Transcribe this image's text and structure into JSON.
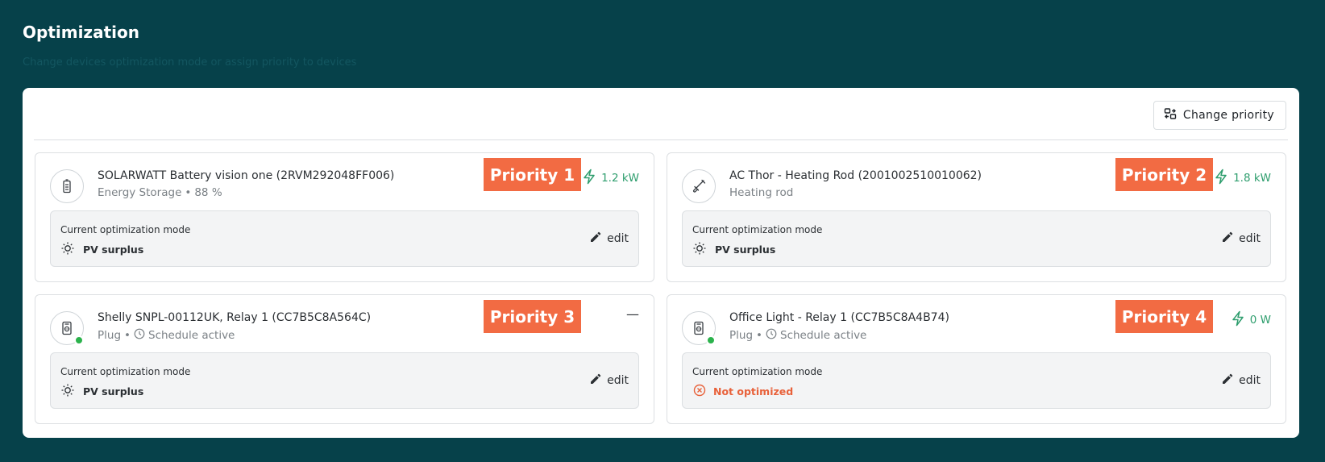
{
  "page": {
    "title": "Optimization",
    "subtitle": "Change devices optimization mode or assign priority to devices"
  },
  "toolbar": {
    "change_priority_label": "Change priority"
  },
  "mode_label": "Current optimization mode",
  "edit_label": "edit",
  "colors": {
    "background": "#06414a",
    "accent_green": "#2f9e6e",
    "priority_badge": "#f26b43",
    "not_optimized": "#e8613a",
    "status_online": "#2bb24c"
  },
  "devices": [
    {
      "name": "SOLARWATT Battery vision one (2RVM292048FF006)",
      "type": "Energy Storage",
      "detail": "88 %",
      "icon": "battery-icon",
      "priority": "Priority 1",
      "power": "1.2 kW",
      "mode": "PV surplus",
      "online": false
    },
    {
      "name": "AC Thor - Heating Rod (2001002510010062)",
      "type": "Heating rod",
      "detail": "",
      "icon": "heating-rod-icon",
      "priority": "Priority 2",
      "power": "1.8 kW",
      "mode": "PV surplus",
      "online": false
    },
    {
      "name": "Shelly SNPL-00112UK, Relay 1 (CC7B5C8A564C)",
      "type": "Plug",
      "detail": "Schedule active",
      "icon": "plug-icon",
      "priority": "Priority 3",
      "power": "—",
      "mode": "PV surplus",
      "online": true
    },
    {
      "name": "Office Light - Relay 1 (CC7B5C8A4B74)",
      "type": "Plug",
      "detail": "Schedule active",
      "icon": "plug-icon",
      "priority": "Priority 4",
      "power": "0 W",
      "mode": "Not optimized",
      "online": true
    }
  ]
}
